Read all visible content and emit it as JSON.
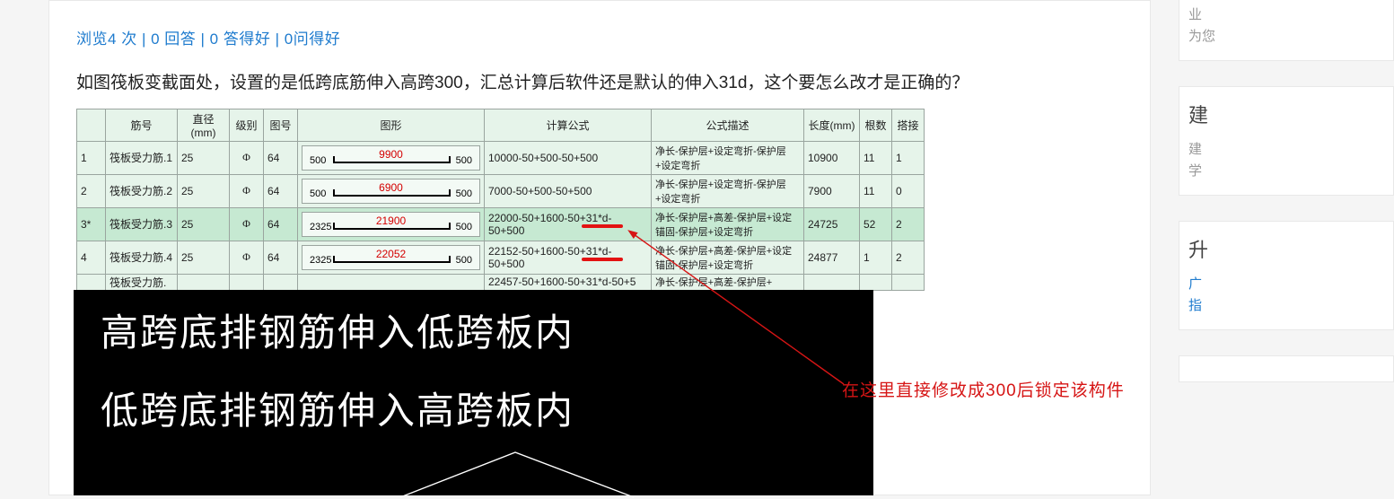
{
  "stats": {
    "views_label": "浏览",
    "views": 4,
    "views_unit": "次",
    "answers": 0,
    "answers_label": "回答",
    "good_answers": 0,
    "good_answers_label": "答得好",
    "good_questions": 0,
    "good_questions_label": "问得好",
    "sep": " | "
  },
  "question_text": "如图筏板变截面处，设置的是低跨底筋伸入高跨300，汇总计算后软件还是默认的伸入31d，这个要怎么改才是正确的？",
  "table": {
    "headers": {
      "rowhead": "",
      "jinhao": "筋号",
      "zhijing": "直径(mm)",
      "jibie": "级别",
      "tuhao": "图号",
      "tuxing": "图形",
      "gongshi": "计算公式",
      "miaoshu": "公式描述",
      "changdu": "长度(mm)",
      "genshu": "根数",
      "dajie": "搭接"
    },
    "rows": [
      {
        "idx": "1",
        "jinhao": "筏板受力筋.1",
        "zhijing": "25",
        "jibie": "Φ",
        "tuhao": "64",
        "shape_l": "500",
        "shape_c": "9900",
        "shape_r": "500",
        "gongshi": "10000-50+500-50+500",
        "miaoshu": "净长-保护层+设定弯折-保护层+设定弯折",
        "changdu": "10900",
        "genshu": "11",
        "dajie": "1",
        "highlight": false
      },
      {
        "idx": "2",
        "jinhao": "筏板受力筋.2",
        "zhijing": "25",
        "jibie": "Φ",
        "tuhao": "64",
        "shape_l": "500",
        "shape_c": "6900",
        "shape_r": "500",
        "gongshi": "7000-50+500-50+500",
        "miaoshu": "净长-保护层+设定弯折-保护层+设定弯折",
        "changdu": "7900",
        "genshu": "11",
        "dajie": "0",
        "highlight": false
      },
      {
        "idx": "3*",
        "jinhao": "筏板受力筋.3",
        "zhijing": "25",
        "jibie": "Φ",
        "tuhao": "64",
        "shape_l": "2325",
        "shape_c": "21900",
        "shape_r": "500",
        "gongshi": "22000-50+1600-50+31*d-50+500",
        "miaoshu": "净长-保护层+高差-保护层+设定锚固-保护层+设定弯折",
        "changdu": "24725",
        "genshu": "52",
        "dajie": "2",
        "highlight": true,
        "red_under": true
      },
      {
        "idx": "4",
        "jinhao": "筏板受力筋.4",
        "zhijing": "25",
        "jibie": "Φ",
        "tuhao": "64",
        "shape_l": "2325",
        "shape_c": "22052",
        "shape_r": "500",
        "gongshi": "22152-50+1600-50+31*d-50+500",
        "miaoshu": "净长-保护层+高差-保护层+设定锚固-保护层+设定弯折",
        "changdu": "24877",
        "genshu": "1",
        "dajie": "2",
        "highlight": false,
        "red_under": true
      },
      {
        "idx": "",
        "jinhao": "筏板受力筋.",
        "zhijing": "",
        "jibie": "",
        "tuhao": "",
        "shape_l": "",
        "shape_c": "",
        "shape_r": "",
        "gongshi": "22457-50+1600-50+31*d-50+5",
        "miaoshu": "净长-保护层+高差-保护层+",
        "changdu": "",
        "genshu": "",
        "dajie": "",
        "highlight": false
      }
    ]
  },
  "cad": {
    "line1": "高跨底排钢筋伸入低跨板内",
    "line2": "低跨底排钢筋伸入高跨板内"
  },
  "annotation": "在这里直接修改成300后锁定该构件",
  "sidebar": {
    "card1_line1": "业",
    "card1_line2": "为您",
    "card2_title": "建",
    "card2_sub1": "建",
    "card2_sub2": "学",
    "card3_title": "升",
    "card3_sub1": "广",
    "card3_sub2": "指"
  }
}
